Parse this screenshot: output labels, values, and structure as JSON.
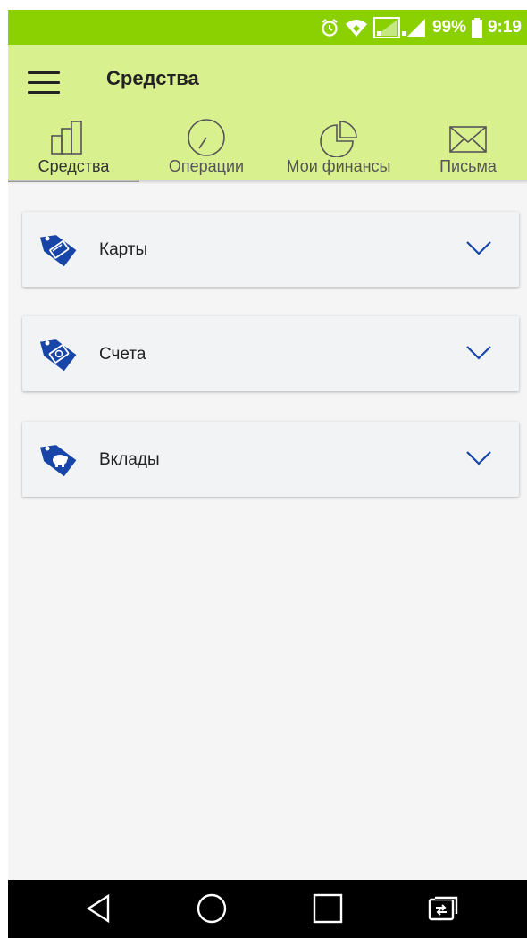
{
  "status_bar": {
    "battery": "99%",
    "time": "9:19",
    "icons": [
      "alarm-icon",
      "wifi-icon",
      "signal-icon",
      "battery-icon"
    ]
  },
  "app_bar": {
    "title": "Средства",
    "menu_icon": "hamburger-menu-icon"
  },
  "tabs": [
    {
      "label": "Средства",
      "icon": "bar-chart-icon",
      "active": true
    },
    {
      "label": "Операции",
      "icon": "clock-icon",
      "active": false
    },
    {
      "label": "Мои финансы",
      "icon": "pie-chart-icon",
      "active": false
    },
    {
      "label": "Письма",
      "icon": "envelope-icon",
      "active": false
    }
  ],
  "sections": [
    {
      "label": "Карты",
      "icon": "card-tag-icon"
    },
    {
      "label": "Счета",
      "icon": "money-tag-icon"
    },
    {
      "label": "Вклады",
      "icon": "piggy-bank-tag-icon"
    }
  ],
  "nav_bar": {
    "buttons": [
      "back-icon",
      "home-icon",
      "recents-icon",
      "switch-icon"
    ]
  },
  "colors": {
    "status_bar": "#8bd000",
    "app_bar": "#d9f08f",
    "accent_blue": "#1846a8",
    "background": "#f5f5f5"
  }
}
